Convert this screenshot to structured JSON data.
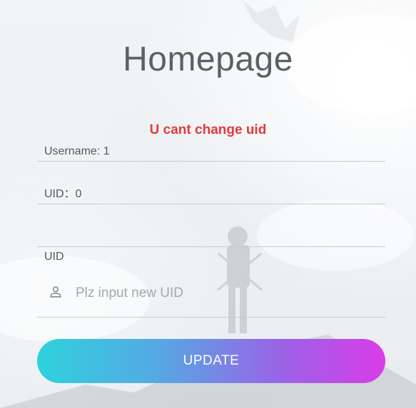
{
  "page": {
    "title": "Homepage",
    "error_message": "U cant change uid"
  },
  "fields": {
    "username": "Username: 1",
    "uid": "UID：0",
    "blank": ""
  },
  "uid_input": {
    "label": "UID",
    "placeholder": "Plz input new UID",
    "value": "",
    "icon": "user-icon"
  },
  "update_button": {
    "label": "UPDATE"
  },
  "colors": {
    "title": "#5b6168",
    "error": "#e23b3b",
    "button_gradient_start": "#2ed2dc",
    "button_gradient_end": "#d93ce8"
  }
}
